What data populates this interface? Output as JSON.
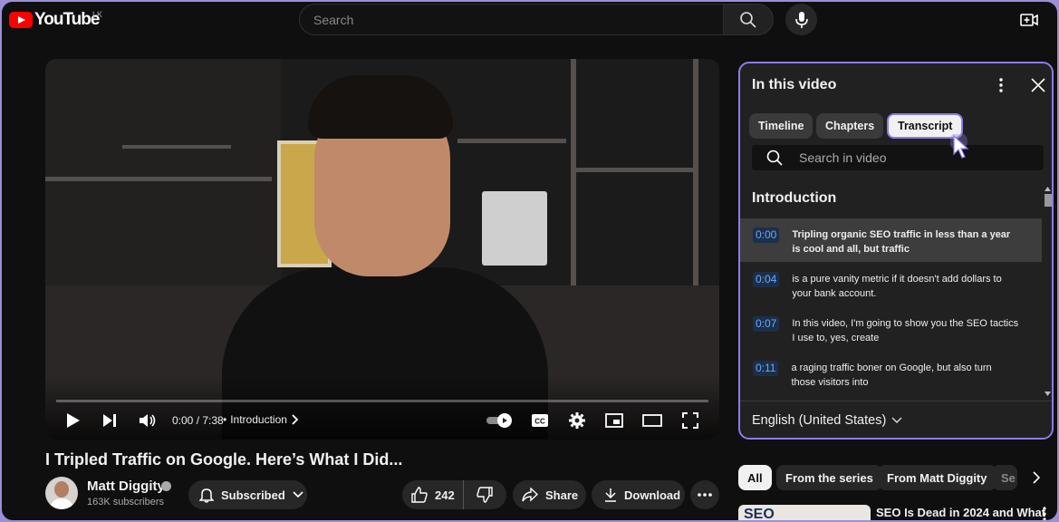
{
  "header": {
    "logo_text": "YouTube",
    "country_code": "LK",
    "search_placeholder": "Search"
  },
  "player": {
    "time": "0:00 / 7:38",
    "chapter": "Introduction",
    "progress": 0.0
  },
  "video": {
    "title": "I Tripled Traffic on Google. Here’s What I Did...",
    "channel": "Matt Diggity",
    "subscribers": "163K subscribers",
    "subscribe_label": "Subscribed",
    "like_count": "242",
    "share_label": "Share",
    "download_label": "Download"
  },
  "panel": {
    "title": "In this video",
    "tabs": [
      {
        "label": "Timeline",
        "active": false
      },
      {
        "label": "Chapters",
        "active": false
      },
      {
        "label": "Transcript",
        "active": true
      }
    ],
    "search_placeholder": "Search in video",
    "section": "Introduction",
    "segments": [
      {
        "time": "0:00",
        "text": "Tripling organic SEO traffic in less than a year is cool and all, but traffic",
        "active": true
      },
      {
        "time": "0:04",
        "text": "is a pure vanity metric if it doesn't add dollars to your bank account.",
        "active": false
      },
      {
        "time": "0:07",
        "text": "In this video, I'm going to show you the SEO tactics I use to, yes, create",
        "active": false
      },
      {
        "time": "0:11",
        "text": "a raging traffic boner on Google, but also turn those visitors into",
        "active": false
      }
    ],
    "language": "English (United States)"
  },
  "filters": [
    "All",
    "From the series",
    "From Matt Diggity",
    "Se"
  ],
  "recommendation": {
    "thumb_text": "SEO",
    "title": "SEO Is Dead in 2024 and What"
  }
}
